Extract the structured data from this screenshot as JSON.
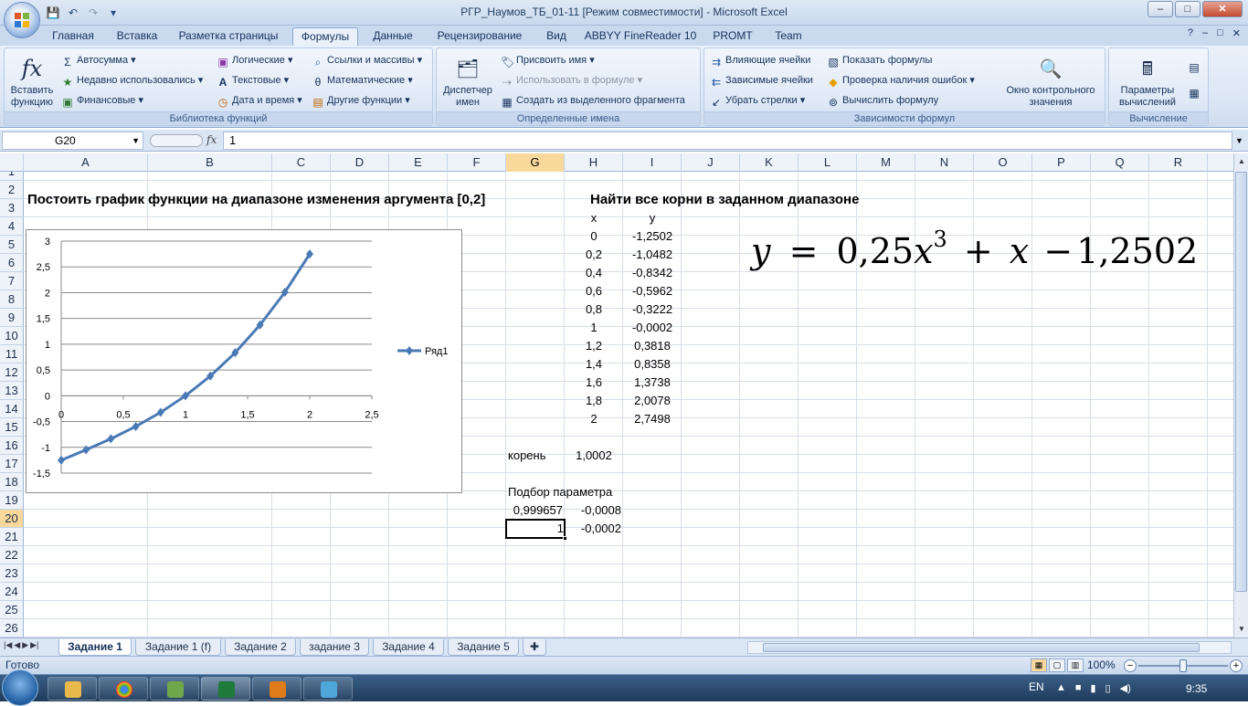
{
  "window": {
    "title": "РГР_Наумов_ТБ_01-11  [Режим совместимости] - Microsoft Excel",
    "controls": [
      "–",
      "□",
      "✕"
    ]
  },
  "qat": {
    "save": "💾",
    "undo": "↶",
    "redo": "↷",
    "more": "▾"
  },
  "tabs": [
    {
      "label": "Главная"
    },
    {
      "label": "Вставка"
    },
    {
      "label": "Разметка страницы"
    },
    {
      "label": "Формулы",
      "active": true
    },
    {
      "label": "Данные"
    },
    {
      "label": "Рецензирование"
    },
    {
      "label": "Вид"
    },
    {
      "label": "ABBYY FineReader 10"
    },
    {
      "label": "PROMT"
    },
    {
      "label": "Team"
    }
  ],
  "ribbon": {
    "library": {
      "label": "Библиотека функций",
      "insert_fn": "Вставить функцию",
      "autosum": "Автосумма",
      "recent": "Недавно использовались",
      "financial": "Финансовые",
      "logical": "Логические",
      "text": "Текстовые",
      "datetime": "Дата и время",
      "lookup": "Ссылки и массивы",
      "math": "Математические",
      "other": "Другие функции"
    },
    "names": {
      "label": "Определенные имена",
      "manager": "Диспетчер имен",
      "define": "Присвоить имя",
      "use_in_formula": "Использовать в формуле",
      "create_from_sel": "Создать из выделенного фрагмента"
    },
    "audit": {
      "label": "Зависимости формул",
      "precedents": "Влияющие ячейки",
      "dependents": "Зависимые ячейки",
      "remove_arrows": "Убрать стрелки",
      "show_formulas": "Показать формулы",
      "error_check": "Проверка наличия ошибок",
      "evaluate": "Вычислить формулу",
      "watch": "Окно контрольного значения"
    },
    "calc": {
      "label": "Вычисление",
      "options": "Параметры вычислений"
    }
  },
  "formula_bar": {
    "name_box": "G20",
    "fx": "fx",
    "value": "1"
  },
  "columns": [
    "A",
    "B",
    "C",
    "D",
    "E",
    "F",
    "G",
    "H",
    "I",
    "J",
    "K",
    "L",
    "M",
    "N",
    "O",
    "P",
    "Q",
    "R"
  ],
  "selected_column": "G",
  "rows": [
    "1",
    "2",
    "3",
    "4",
    "5",
    "6",
    "7",
    "8",
    "9",
    "10",
    "11",
    "12",
    "13",
    "14",
    "15",
    "16",
    "17",
    "18",
    "19",
    "20",
    "21",
    "22",
    "23",
    "24",
    "25",
    "26"
  ],
  "selected_row": "20",
  "cells": {
    "a2": "Постоить график функции на диапазоне изменения аргумента [0,2]",
    "h2": "Найти все корни в заданном диапазоне",
    "h3": "x",
    "i3": "y",
    "x_values": [
      "0",
      "0,2",
      "0,4",
      "0,6",
      "0,8",
      "1",
      "1,2",
      "1,4",
      "1,6",
      "1,8",
      "2"
    ],
    "y_values": [
      "-1,2502",
      "-1,0482",
      "-0,8342",
      "-0,5962",
      "-0,3222",
      "-0,0002",
      "0,3818",
      "0,8358",
      "1,3738",
      "2,0078",
      "2,7498"
    ],
    "g16": "корень",
    "h16": "1,0002",
    "g18": "Подбор параметра",
    "g19": "0,999657",
    "h19": "-0,0008",
    "g20": "1",
    "h20": "-0,0002"
  },
  "equation": {
    "y": "y",
    "eq": "=",
    "coef": "0,25",
    "x": "x",
    "exp": "3",
    "plus": "+",
    "x2": "x",
    "minus": "−",
    "const": "1,2502"
  },
  "chart_data": {
    "type": "line",
    "x": [
      0,
      0.2,
      0.4,
      0.6,
      0.8,
      1,
      1.2,
      1.4,
      1.6,
      1.8,
      2
    ],
    "series": [
      {
        "name": "Ряд1",
        "values": [
          -1.2502,
          -1.0482,
          -0.8342,
          -0.5962,
          -0.3222,
          -0.0002,
          0.3818,
          0.8358,
          1.3738,
          2.0078,
          2.7498
        ],
        "color": "#4a7ab5"
      }
    ],
    "xlim": [
      0,
      2.5
    ],
    "ylim": [
      -1.5,
      3
    ],
    "x_ticks": [
      "0",
      "0,5",
      "1",
      "1,5",
      "2",
      "2,5"
    ],
    "y_ticks": [
      "3",
      "2,5",
      "2",
      "1,5",
      "1",
      "0,5",
      "0",
      "-0,5",
      "-1",
      "-1,5"
    ],
    "grid": true,
    "legend": "right"
  },
  "sheets": [
    {
      "label": "Задание 1",
      "active": true
    },
    {
      "label": "Задание 1 (f)"
    },
    {
      "label": "Задание 2"
    },
    {
      "label": "задание 3"
    },
    {
      "label": "Задание 4"
    },
    {
      "label": "Задание 5"
    }
  ],
  "status": {
    "text": "Готово",
    "zoom": "100%",
    "zoom_fraction": 0.5
  },
  "taskbar": {
    "lang": "EN",
    "clock": "9:35"
  }
}
